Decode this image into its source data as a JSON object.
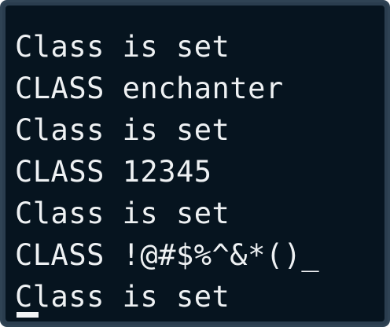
{
  "terminal": {
    "lines": [
      "Class is set",
      "CLASS enchanter",
      "Class is set",
      "CLASS 12345",
      "Class is set",
      "CLASS !@#$%^&*()_",
      "Class is set"
    ]
  },
  "colors": {
    "background": "#06141f",
    "text": "#eef1f3",
    "border": "#2f4354"
  }
}
